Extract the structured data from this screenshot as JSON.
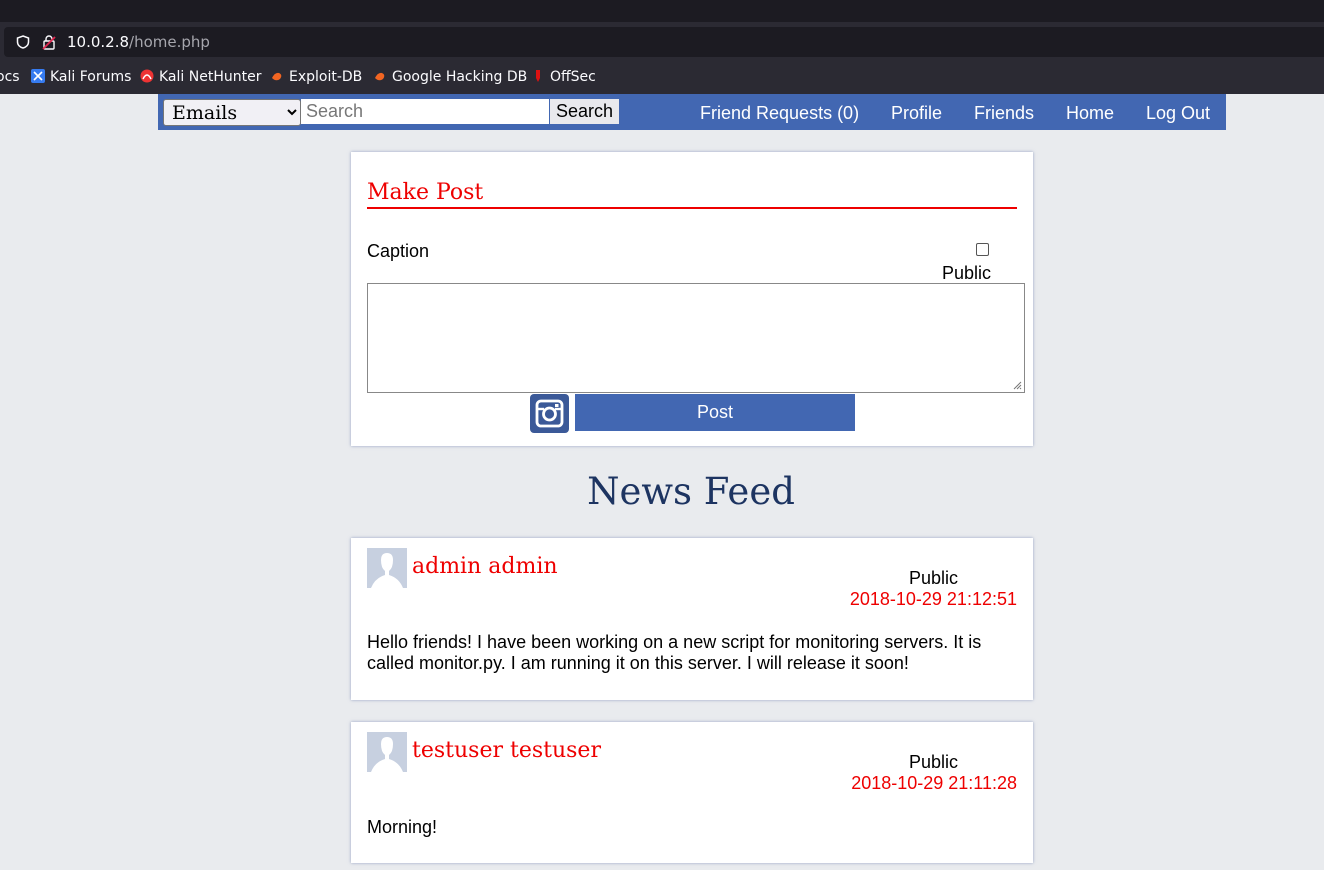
{
  "browser": {
    "url_host": "10.0.2.8",
    "url_path": "/home.php",
    "bookmarks": [
      {
        "label": "ocs",
        "icon": "none"
      },
      {
        "label": "Kali Forums",
        "icon": "kali-forums-icon"
      },
      {
        "label": "Kali NetHunter",
        "icon": "kali-nethunter-icon"
      },
      {
        "label": "Exploit-DB",
        "icon": "exploit-db-icon"
      },
      {
        "label": "Google Hacking DB",
        "icon": "ghdb-icon"
      },
      {
        "label": "OffSec",
        "icon": "offsec-icon"
      }
    ]
  },
  "nav": {
    "select_value": "Emails",
    "search_placeholder": "Search",
    "search_button": "Search",
    "links": [
      "Friend Requests (0)",
      "Profile",
      "Friends",
      "Home",
      "Log Out"
    ],
    "color": "#4267b2"
  },
  "make_post": {
    "title": "Make Post",
    "caption_label": "Caption",
    "public_label": "Public",
    "public_checked": false,
    "caption_value": "",
    "post_button": "Post",
    "image_icon": "instagram-icon"
  },
  "feed": {
    "title": "News Feed",
    "posts": [
      {
        "author": "admin admin",
        "privacy": "Public",
        "timestamp": "2018-10-29 21:12:51",
        "body": "Hello friends! I have been working on a new script for monitoring servers. It is called monitor.py. I am running it on this server. I will release it soon!"
      },
      {
        "author": "testuser testuser",
        "privacy": "Public",
        "timestamp": "2018-10-29 21:11:28",
        "body": "Morning!"
      }
    ]
  },
  "colors": {
    "accent_red": "#ee0000",
    "page_bg": "#e9ebee",
    "feed_title": "#1d3461"
  }
}
